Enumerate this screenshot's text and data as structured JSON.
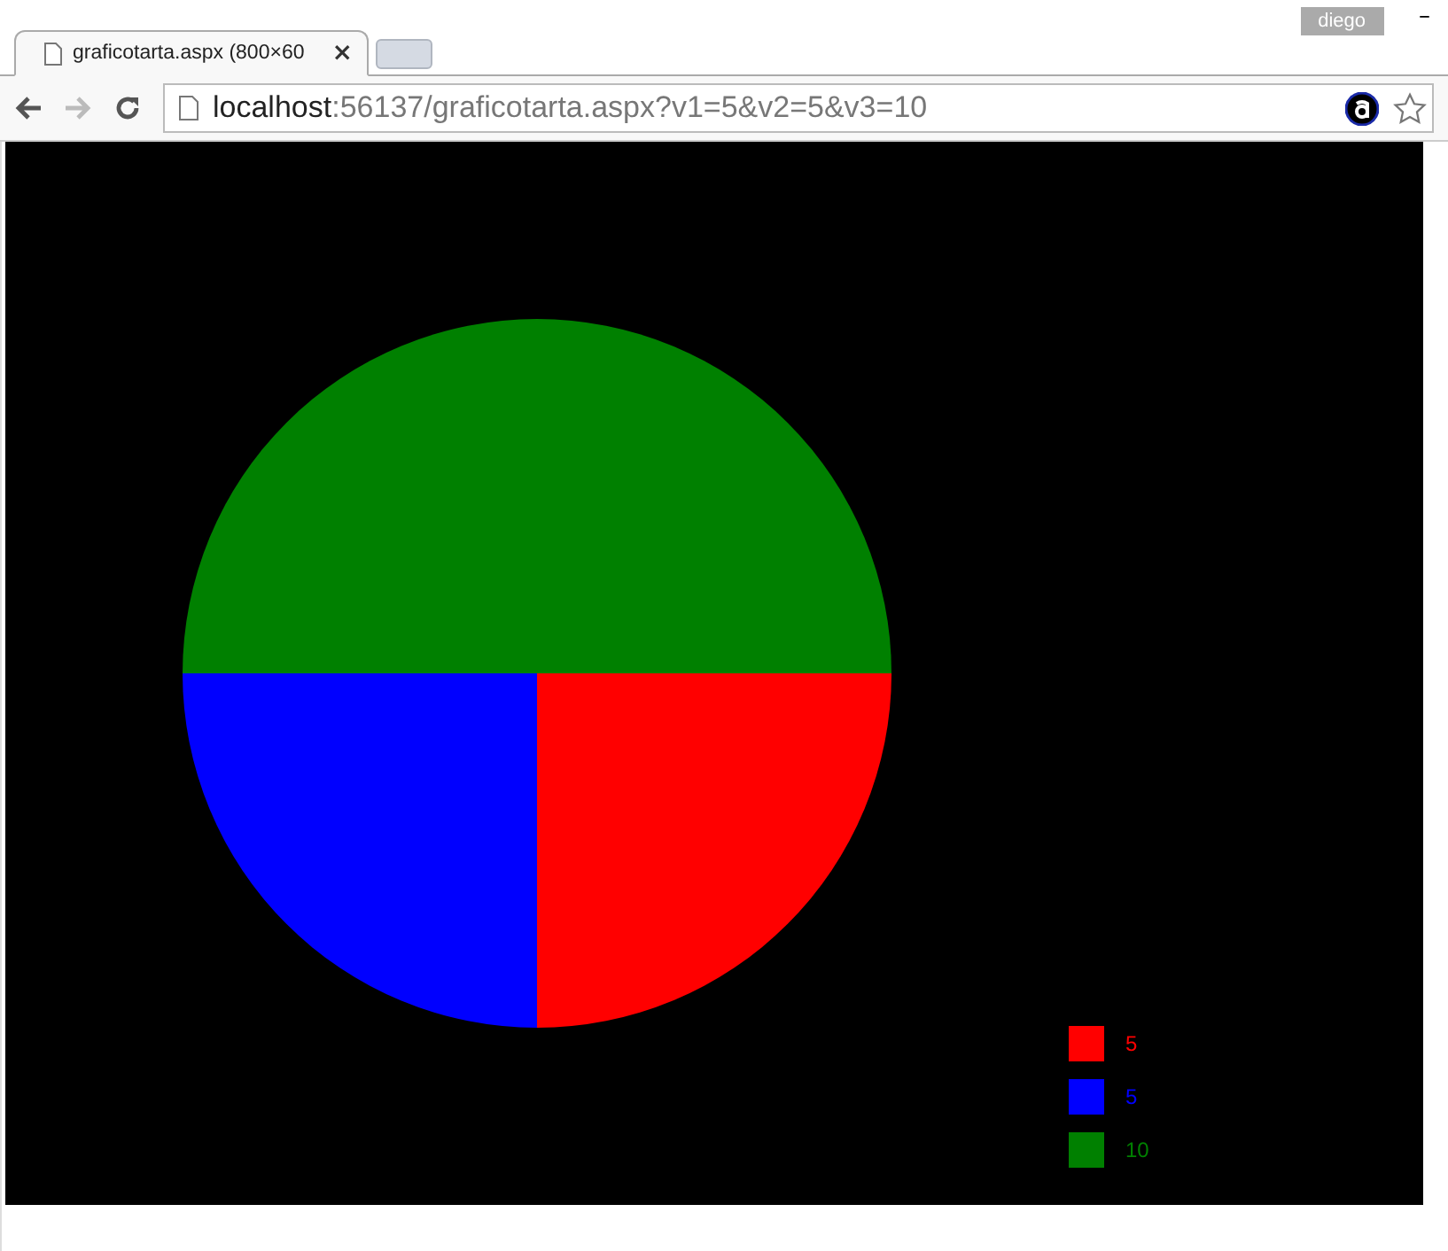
{
  "browser": {
    "profile": "diego",
    "minimize": "–",
    "tabs": [
      {
        "title": "graficotarta.aspx (800×60",
        "selected": true,
        "close": "×"
      }
    ],
    "address": {
      "host": "localhost",
      "rest": ":56137/graficotarta.aspx?v1=5&v2=5&v3=10"
    }
  },
  "chart": {
    "chart_data": {
      "type": "pie",
      "categories": [
        "5",
        "5",
        "10"
      ],
      "values": [
        5,
        5,
        10
      ]
    },
    "legend": [
      {
        "color": "#ff0000"
      },
      {
        "color": "#0000ff"
      },
      {
        "color": "#008000"
      }
    ]
  }
}
